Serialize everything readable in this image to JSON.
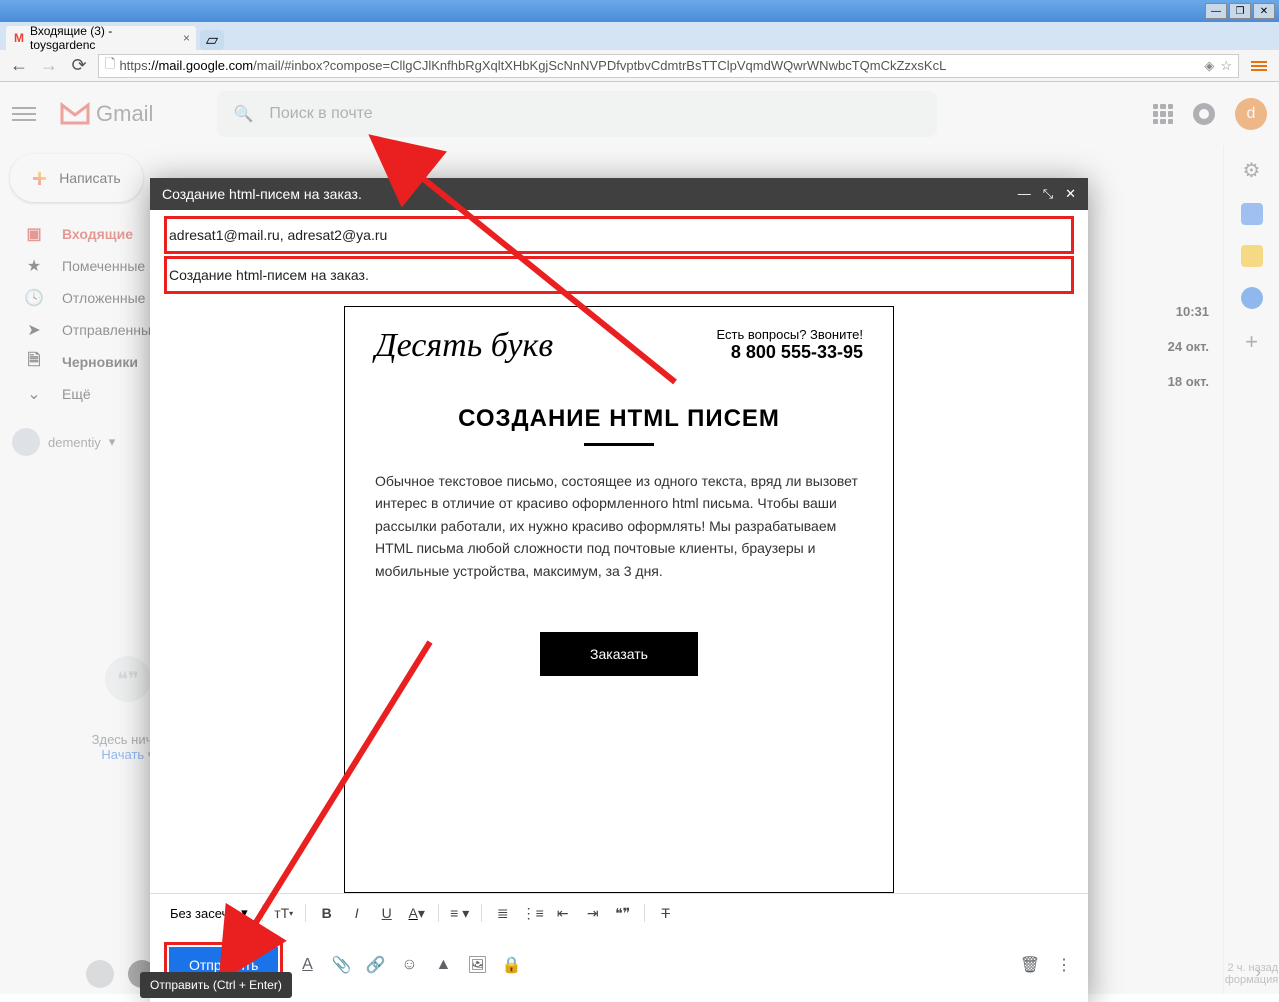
{
  "window": {
    "title": "Входящие (3) - toysgarden"
  },
  "browser": {
    "tab_title": "Входящие (3) - toysgardenс",
    "url_scheme": "https",
    "url_host": "://mail.google.com",
    "url_path": "/mail/#inbox?compose=CllgCJlKnfhbRgXqltXHbKgjScNnNVPDfvptbvCdmtrBsTTClpVqmdWQwrWNwbcTQmCkZzxsKcL"
  },
  "gmail": {
    "product": "Gmail",
    "search_placeholder": "Поиск в почте",
    "avatar_letter": "d",
    "compose": "Написать",
    "folders": {
      "inbox": "Входящие",
      "starred": "Помеченные",
      "snoozed": "Отложенные",
      "sent": "Отправленные",
      "drafts": "Черновики",
      "more": "Ещё"
    },
    "user": "dementiy",
    "hangouts_empty": "Здесь ничег",
    "hangouts_link": "Начать ч",
    "times": {
      "t1": "10:31",
      "t2": "24 окт.",
      "t3": "18 окт."
    },
    "footer_time": "2 ч. назад",
    "footer_text": "формация"
  },
  "compose": {
    "title": "Создание html-писем на заказ.",
    "to": "adresat1@mail.ru, adresat2@ya.ru",
    "subject": "Создание html-писем на заказ.",
    "send": "Отправить",
    "tooltip": "Отправить (Ctrl + Enter)",
    "font_label": "Без засеч..."
  },
  "email": {
    "brand": "Десять букв",
    "question": "Есть вопросы? Звоните!",
    "phone": "8 800 555-33-95",
    "heading": "СОЗДАНИЕ HTML ПИСЕМ",
    "body": "Обычное текстовое письмо, состоящее из одного текста, вряд ли вызовет интерес в отличие от красиво оформленного html письма. Чтобы ваши рассылки работали, их нужно красиво оформлять! Мы разрабатываем HTML письма любой сложности под почтовые клиенты, браузеры и мобильные устройства, максимум, за 3 дня.",
    "cta": "Заказать"
  }
}
